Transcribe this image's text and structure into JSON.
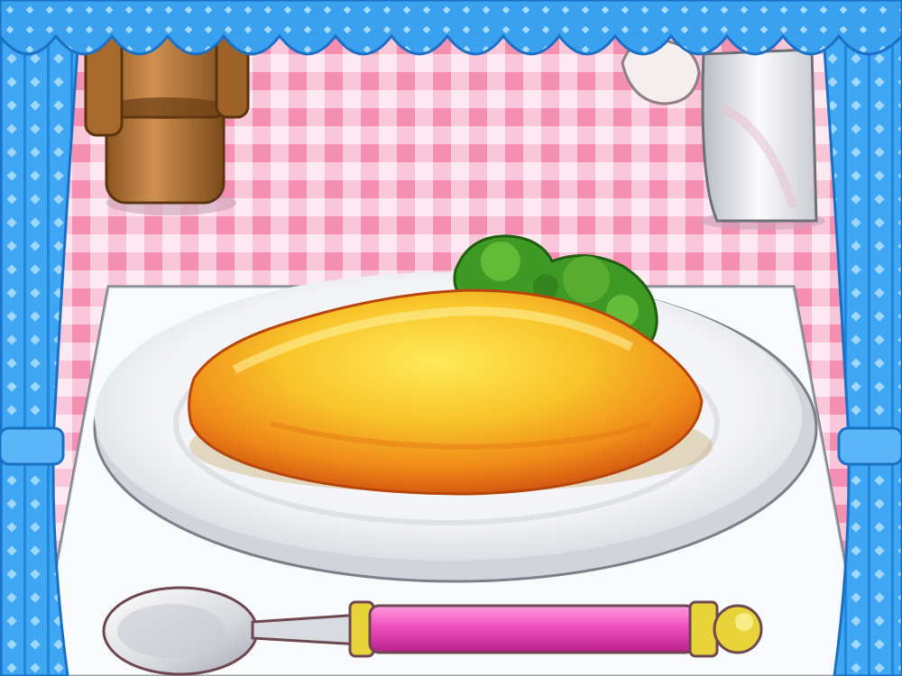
{
  "scene": {
    "type": "cooking-game-dish-presentation",
    "dish": "omelette",
    "garnish": "broccoli",
    "utensil": "spoon"
  },
  "colors": {
    "curtain_blue": "#3aa0f0",
    "curtain_light": "#8fd2ff",
    "tablecloth_pink": "#f7a7c3",
    "tablecloth_white": "#fde9f1",
    "placemat": "#ffffff",
    "plate": "#f3f4f7",
    "omelette": "#f4b21a",
    "omelette_edge": "#e36e12",
    "broccoli": "#3f9a25",
    "spoon_handle": "#f05ac0",
    "spoon_gold": "#e8d43a",
    "spoon_silver": "#d9dbe0",
    "pepper_shaker": "#c98a43"
  },
  "icons": [
    "pepper-shaker-icon",
    "salt-shaker-icon",
    "napkin-holder-icon"
  ]
}
